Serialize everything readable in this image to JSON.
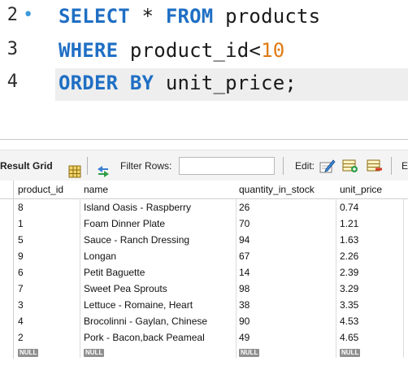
{
  "editor": {
    "lines": [
      {
        "number": "2",
        "bullet": "•",
        "kw1": "SELECT",
        "rest1": " * ",
        "kw2": "FROM",
        "rest2": " products"
      },
      {
        "number": "3",
        "kw1": "WHERE",
        "rest1": " product_id",
        "op": "<",
        "num": "10"
      },
      {
        "number": "4",
        "kw1": "ORDER BY",
        "rest1": " unit_price;"
      }
    ]
  },
  "toolbar": {
    "result_grid_label": "Result Grid",
    "filter_rows_label": "Filter Rows:",
    "filter_value": "",
    "edit_label": "Edit:",
    "trailing_label": "E"
  },
  "grid": {
    "columns": [
      "product_id",
      "name",
      "quantity_in_stock",
      "unit_price"
    ],
    "rows": [
      [
        "8",
        "Island Oasis - Raspberry",
        "26",
        "0.74"
      ],
      [
        "1",
        "Foam Dinner Plate",
        "70",
        "1.21"
      ],
      [
        "5",
        "Sauce - Ranch Dressing",
        "94",
        "1.63"
      ],
      [
        "9",
        "Longan",
        "67",
        "2.26"
      ],
      [
        "6",
        "Petit Baguette",
        "14",
        "2.39"
      ],
      [
        "7",
        "Sweet Pea Sprouts",
        "98",
        "3.29"
      ],
      [
        "3",
        "Lettuce - Romaine, Heart",
        "38",
        "3.35"
      ],
      [
        "4",
        "Brocolinni - Gaylan, Chinese",
        "90",
        "4.53"
      ],
      [
        "2",
        "Pork - Bacon,back Peameal",
        "49",
        "4.65"
      ]
    ],
    "null_label": "NULL"
  },
  "colors": {
    "keyword": "#1f6fc4",
    "number": "#e07a12",
    "current_line": "#eeeeee",
    "null_badge": "#8f8f8f"
  },
  "icons": {
    "grid_view": "grid-icon",
    "filter": "filter-arrows-icon",
    "edit": "edit-pencil-icon",
    "add_row": "add-row-icon",
    "delete_row": "delete-row-icon"
  }
}
